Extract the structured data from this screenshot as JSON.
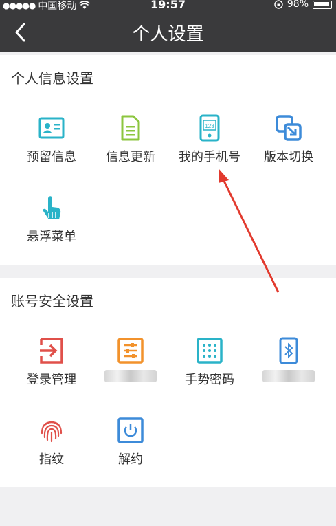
{
  "status": {
    "carrier": "中国移动",
    "signal_dots": "●●●●●",
    "time": "19:57",
    "battery": "98%"
  },
  "nav": {
    "title": "个人设置"
  },
  "personal": {
    "title": "个人信息设置",
    "items": [
      {
        "label": "预留信息",
        "icon": "id-card-icon"
      },
      {
        "label": "信息更新",
        "icon": "document-icon"
      },
      {
        "label": "我的手机号",
        "icon": "phone-number-icon"
      },
      {
        "label": "版本切换",
        "icon": "switch-icon"
      },
      {
        "label": "悬浮菜单",
        "icon": "hand-pointer-icon"
      }
    ]
  },
  "security": {
    "title": "账号安全设置",
    "items": [
      {
        "label": "登录管理",
        "icon": "login-icon"
      },
      {
        "label": "",
        "icon": "sliders-icon"
      },
      {
        "label": "手势密码",
        "icon": "gesture-grid-icon"
      },
      {
        "label": "",
        "icon": "bluetooth-icon"
      },
      {
        "label": "指纹",
        "icon": "fingerprint-icon"
      },
      {
        "label": "解约",
        "icon": "power-icon"
      }
    ]
  },
  "colors": {
    "header": "#3a3a3c",
    "cyan": "#2ab3c8",
    "green": "#8cc63f",
    "blue": "#3d8bd9",
    "red": "#e0504a",
    "orange": "#f2922c",
    "arrow": "#e23a2e"
  }
}
